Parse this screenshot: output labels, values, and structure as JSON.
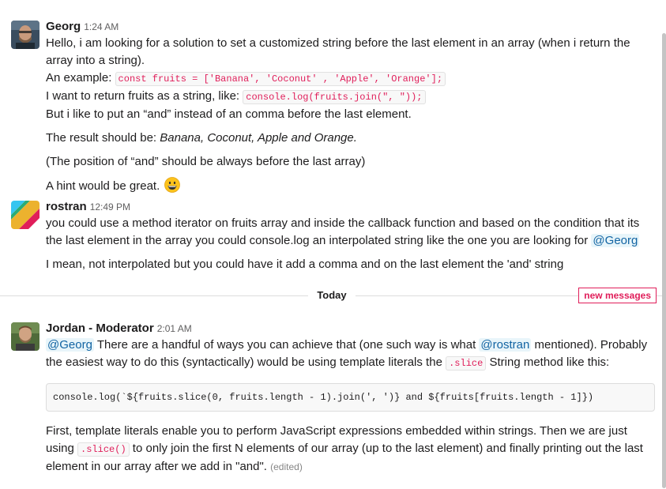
{
  "messages": {
    "georg": {
      "name": "Georg",
      "time": "1:24 AM",
      "line1": "Hello, i  am looking for a solution to set a customized string before the last element in an array (when i return the array into a string).",
      "example_label": "An example: ",
      "example_code": "const fruits = ['Banana', 'Coconut' , 'Apple', 'Orange'];",
      "want_label": "I want to return fruits as a string, like: ",
      "want_code": "console.log(fruits.join(\", \"));",
      "line4": "But i like to put an “and” instead of an comma before the last element.",
      "result_label": "The result should be: ",
      "result_value": "Banana, Coconut, Apple and Orange.",
      "position_note": "(The position of “and” should be always before the last array)",
      "hint": "A hint would be great.",
      "hint_emoji": "grinning-face-emoji"
    },
    "rostran": {
      "name": "rostran",
      "time": "12:49 PM",
      "line1": "you could use a method iterator on fruits array and inside the callback function and  based on the condition that its the last element in the array you could console.log an interpolated string like the one you are looking for ",
      "line1_mention": "@Georg",
      "line2": "I mean, not interpolated but you could have it add a comma and on the last element the 'and' string"
    },
    "jordan": {
      "name": "Jordan - Moderator",
      "time": "2:01 AM",
      "mention1": "@Georg",
      "text1": " There are a handful of ways you can achieve that (one such way is what ",
      "mention2": "@rostran",
      "text2": " mentioned).  Probably the easiest way to do this (syntactically) would be using template literals the ",
      "code1": ".slice",
      "text3": " String method like this:",
      "codeblock": "console.log(`${fruits.slice(0, fruits.length - 1).join(', ')} and ${fruits[fruits.length - 1]})",
      "text4": "First, template literals enable you to perform JavaScript expressions embedded within strings.  Then we are just using ",
      "code2": ".slice()",
      "text5": " to only join the first N elements of our array (up to the last element) and finally printing out the last element in our array after we add in \"and\".",
      "edited": "(edited)"
    }
  },
  "divider": {
    "label": "Today",
    "new_messages": "new messages"
  },
  "colors": {
    "accent_red": "#e01e5a",
    "mention_blue": "#1264a3"
  }
}
